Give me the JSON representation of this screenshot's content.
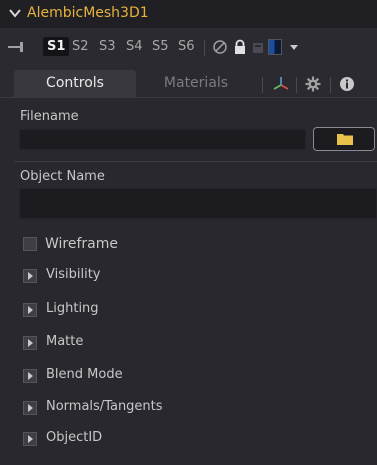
{
  "header": {
    "title": "AlembicMesh3D1"
  },
  "toolbar": {
    "slots": [
      "S1",
      "S2",
      "S3",
      "S4",
      "S5",
      "S6"
    ],
    "active_slot": "S1"
  },
  "tabs": [
    {
      "label": "Controls",
      "active": true
    },
    {
      "label": "Materials",
      "active": false
    }
  ],
  "filename": {
    "label": "Filename",
    "value": ""
  },
  "object_name": {
    "label": "Object Name",
    "value": ""
  },
  "wireframe": {
    "label": "Wireframe",
    "checked": false
  },
  "sections": [
    {
      "label": "Visibility"
    },
    {
      "label": "Lighting"
    },
    {
      "label": "Matte"
    },
    {
      "label": "Blend Mode"
    },
    {
      "label": "Normals/Tangents"
    },
    {
      "label": "ObjectID"
    }
  ],
  "colors": {
    "title": "#e8b33c",
    "background": "#28282e",
    "field": "#1c1c20"
  }
}
